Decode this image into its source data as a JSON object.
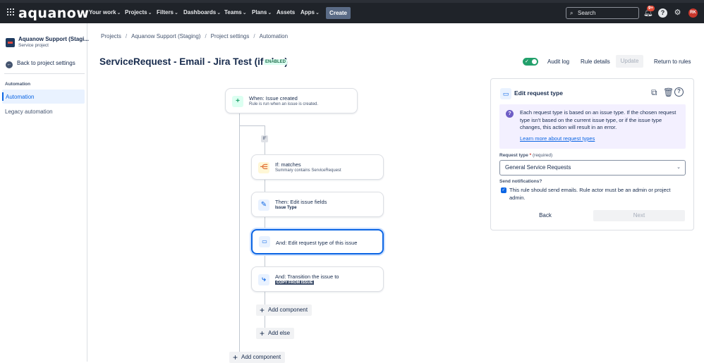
{
  "topnav": {
    "logo": "aquanow",
    "items": [
      "Your work",
      "Projects",
      "Filters",
      "Dashboards",
      "Teams",
      "Plans",
      "Assets",
      "Apps"
    ],
    "create_label": "Create",
    "search_placeholder": "Search",
    "notif_badge": "9+",
    "avatar_initials": "RK"
  },
  "sidebar": {
    "project_name": "Aquanow Support (Stagi...",
    "project_type": "Service project",
    "back_label": "Back to project settings",
    "section_title": "Automation",
    "active_item": "Automation",
    "item_legacy": "Legacy automation"
  },
  "breadcrumbs": [
    "Projects",
    "Aquanow Support (Staging)",
    "Project settings",
    "Automation"
  ],
  "header": {
    "rule_title": "ServiceRequest - Email - Jira Test (if else)",
    "status": "ENABLED",
    "audit_log": "Audit log",
    "rule_details": "Rule details",
    "update": "Update",
    "return": "Return to rules"
  },
  "flow": {
    "trigger_title": "When: Issue created",
    "trigger_sub": "Rule is run when an issue is created.",
    "if_marker": "IF",
    "cond_title": "If: matches",
    "cond_sub": "Summary contains ServiceRequest",
    "action1_title": "Then: Edit issue fields",
    "action1_sub": "Issue Type",
    "action2_title": "And: Edit request type of this issue",
    "action3_title": "And: Transition the issue to",
    "action3_lozenge": "COPY FROM ISSUE",
    "add_component_inner": "Add component",
    "add_else": "Add else",
    "add_component_outer": "Add component"
  },
  "panel": {
    "title": "Edit request type",
    "info_text": "Each request type is based on an issue type. If the chosen request type isn't based on the current issue type, or if the issue type changes, this action will result in an error.",
    "info_link": "Learn more about request types",
    "field_label": "Request type",
    "required_star": "*",
    "required_text": "(required)",
    "field_value": "General Service Requests",
    "notify_label": "Send notifications?",
    "notify_text": "This rule should send emails. Rule actor must be an admin or project admin.",
    "back_btn": "Back",
    "next_btn": "Next"
  }
}
